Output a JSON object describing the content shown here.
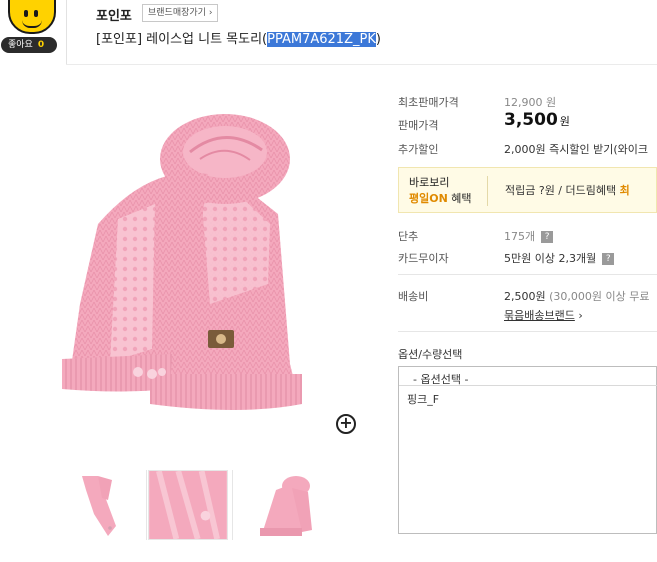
{
  "header": {
    "like_label": "좋아요",
    "like_count": "0",
    "brand_name": "포인포",
    "brand_shop_link": "브랜드매장가기 ›",
    "title_prefix": "[포인포] 레이스업 니트 목도리(",
    "title_code": "PPAM7A621Z_PK",
    "title_suffix": ")"
  },
  "info": {
    "first_price_label": "최초판매가격",
    "first_price_value": "12,900 원",
    "sale_price_label": "판매가격",
    "sale_price_value": "3,500",
    "sale_price_unit": "원",
    "extra_discount_label": "추가할인",
    "extra_discount_value": "2,000원 즉시할인 받기(와이크",
    "baro_line1": "바로보리",
    "baro_line2_highlight": "평일ON",
    "baro_line2_rest": " 혜택",
    "baro_benefit_text": "적립금 ?원 / 더드림혜택 ",
    "baro_benefit_highlight": "최",
    "unit_label": "단추",
    "unit_value": "175개",
    "card_label": "카드무이자",
    "card_value": "5만원 이상 2,3개월",
    "shipping_label": "배송비",
    "shipping_value": "2,500원",
    "shipping_note": " (30,000원 이상 무료",
    "bundle_link": "묶음배송브랜드",
    "bundle_arrow": "›",
    "qmark": "?"
  },
  "options": {
    "title": "옵션/수량선택",
    "placeholder": "- 옵션선택 -",
    "items": [
      "핑크_F"
    ]
  },
  "zoom_symbol": "+",
  "colors": {
    "scarf_pink": "#f4a9bd",
    "accent_orange": "#e08a00",
    "selection_blue": "#3c78d8",
    "like_yellow": "#ffd200"
  }
}
